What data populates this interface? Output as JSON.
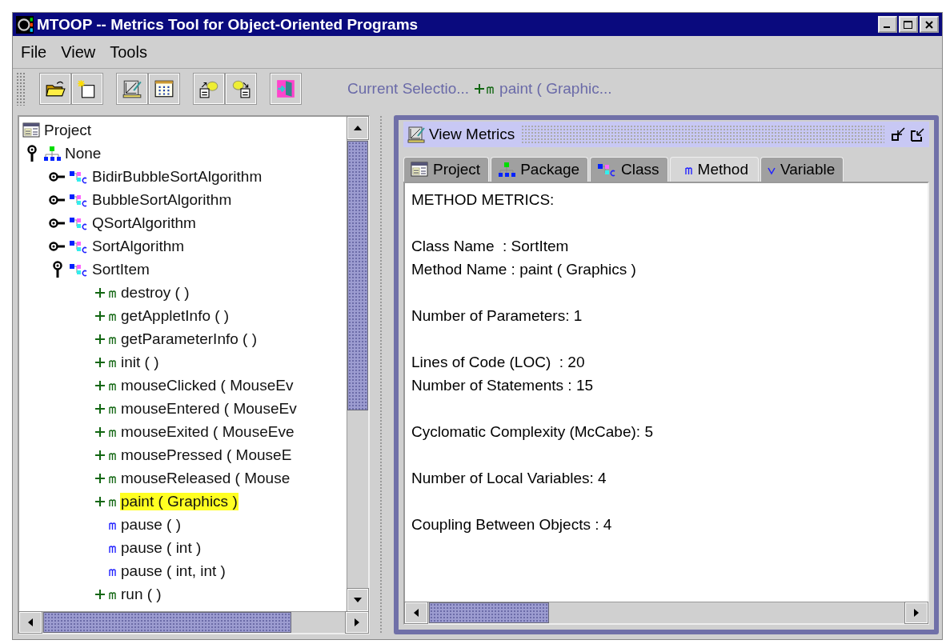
{
  "window": {
    "title": "MTOOP -- Metrics Tool for Object-Oriented Programs"
  },
  "menu": [
    {
      "label": "File"
    },
    {
      "label": "View"
    },
    {
      "label": "Tools"
    }
  ],
  "current_selection": {
    "label": "Current Selectio...",
    "kind": "public-method",
    "value": "paint ( Graphic..."
  },
  "tree": [
    {
      "label": "Project",
      "kind": "project",
      "selected": false,
      "children": [
        {
          "label": "None",
          "kind": "package",
          "expanded": true,
          "selected": false,
          "children": [
            {
              "label": "BidirBubbleSortAlgorithm",
              "kind": "class",
              "expanded": false,
              "selected": false
            },
            {
              "label": "BubbleSortAlgorithm",
              "kind": "class",
              "expanded": false,
              "selected": false
            },
            {
              "label": "QSortAlgorithm",
              "kind": "class",
              "expanded": false,
              "selected": false
            },
            {
              "label": "SortAlgorithm",
              "kind": "class",
              "expanded": false,
              "selected": false
            },
            {
              "label": "SortItem",
              "kind": "class",
              "expanded": true,
              "selected": false,
              "children": [
                {
                  "label": "destroy ( )",
                  "kind": "public-method",
                  "selected": false
                },
                {
                  "label": "getAppletInfo ( )",
                  "kind": "public-method",
                  "selected": false
                },
                {
                  "label": "getParameterInfo ( )",
                  "kind": "public-method",
                  "selected": false
                },
                {
                  "label": "init ( )",
                  "kind": "public-method",
                  "selected": false
                },
                {
                  "label": "mouseClicked ( MouseEv",
                  "kind": "public-method",
                  "selected": false
                },
                {
                  "label": "mouseEntered ( MouseEv",
                  "kind": "public-method",
                  "selected": false
                },
                {
                  "label": "mouseExited ( MouseEve",
                  "kind": "public-method",
                  "selected": false
                },
                {
                  "label": "mousePressed ( MouseE",
                  "kind": "public-method",
                  "selected": false
                },
                {
                  "label": "mouseReleased ( Mouse",
                  "kind": "public-method",
                  "selected": false
                },
                {
                  "label": "paint ( Graphics )",
                  "kind": "public-method",
                  "selected": true
                },
                {
                  "label": "pause ( )",
                  "kind": "method",
                  "selected": false
                },
                {
                  "label": "pause ( int )",
                  "kind": "method",
                  "selected": false
                },
                {
                  "label": "pause ( int, int )",
                  "kind": "method",
                  "selected": false
                },
                {
                  "label": "run ( )",
                  "kind": "public-method",
                  "selected": false
                }
              ]
            }
          ]
        }
      ]
    }
  ],
  "metrics_window": {
    "title": "View Metrics",
    "tabs": [
      {
        "label": "Project",
        "kind": "project",
        "selected": false
      },
      {
        "label": "Package",
        "kind": "package",
        "selected": false
      },
      {
        "label": "Class",
        "kind": "class",
        "selected": false
      },
      {
        "label": "Method",
        "kind": "method",
        "selected": true
      },
      {
        "label": "Variable",
        "kind": "variable",
        "selected": false
      }
    ],
    "paragraphs": [
      [
        "METHOD METRICS:"
      ],
      [
        "Class Name  : SortItem",
        "Method Name : paint ( Graphics )"
      ],
      [
        "Number of Parameters: 1"
      ],
      [
        "Lines of Code (LOC)  : 20",
        "Number of Statements : 15"
      ],
      [
        "Cyclomatic Complexity (McCabe): 5"
      ],
      [
        "Number of Local Variables: 4"
      ],
      [
        "Coupling Between Objects : 4"
      ]
    ]
  }
}
